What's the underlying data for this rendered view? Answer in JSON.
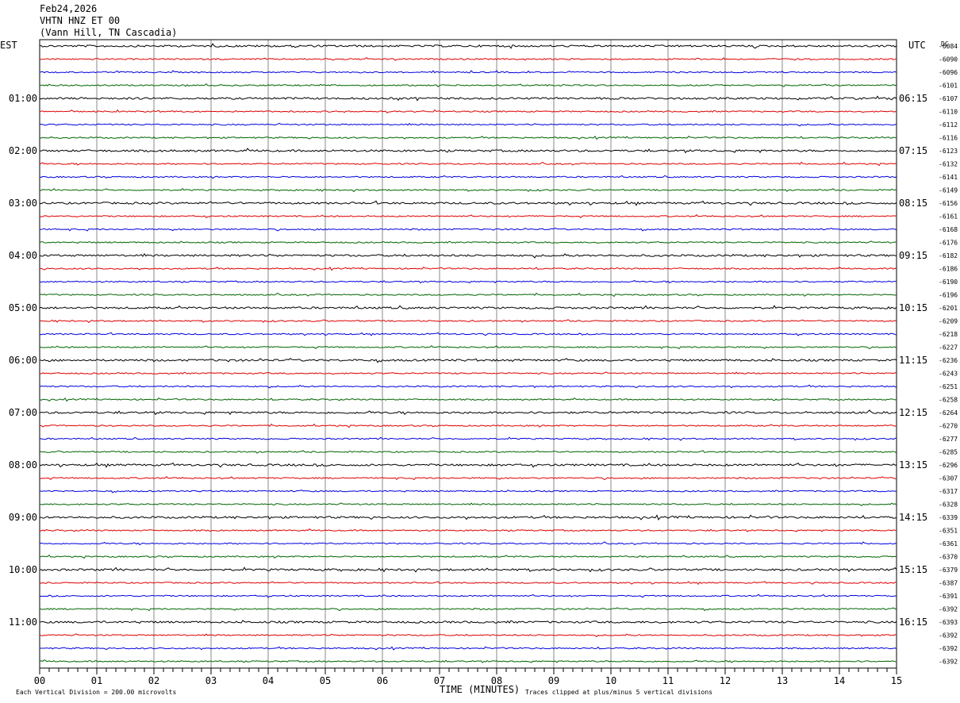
{
  "header": {
    "date": "Feb24,2026",
    "station": "VHTN HNZ ET 00",
    "location": "(Vann Hill, TN Cascadia)"
  },
  "chart_data": {
    "type": "line",
    "left_zone": "EST",
    "right_zone": "UTC",
    "dc_label": "DC",
    "xlabel": "TIME (MINUTES)",
    "x_ticks": [
      "00",
      "01",
      "02",
      "03",
      "04",
      "05",
      "06",
      "07",
      "08",
      "09",
      "10",
      "11",
      "12",
      "13",
      "14",
      "15"
    ],
    "xlim": [
      0,
      15
    ],
    "est_labels": [
      "01:00",
      "02:00",
      "03:00",
      "04:00",
      "05:00",
      "06:00",
      "07:00",
      "08:00",
      "09:00",
      "10:00",
      "11:00"
    ],
    "utc_labels": [
      "06:15",
      "07:15",
      "08:15",
      "09:15",
      "10:15",
      "11:15",
      "12:15",
      "13:15",
      "14:15",
      "15:15",
      "16:15"
    ],
    "dc_offsets": [
      "-6084",
      "-6090",
      "-6096",
      "-6101",
      "-6107",
      "-6110",
      "-6112",
      "-6116",
      "-6123",
      "-6132",
      "-6141",
      "-6149",
      "-6156",
      "-6161",
      "-6168",
      "-6176",
      "-6182",
      "-6186",
      "-6190",
      "-6196",
      "-6201",
      "-6209",
      "-6218",
      "-6227",
      "-6236",
      "-6243",
      "-6251",
      "-6258",
      "-6264",
      "-6270",
      "-6277",
      "-6285",
      "-6296",
      "-6307",
      "-6317",
      "-6328",
      "-6339",
      "-6351",
      "-6361",
      "-6370",
      "-6379",
      "-6387",
      "-6391",
      "-6392",
      "-6393",
      "-6392",
      "-6392",
      "-6392"
    ],
    "trace_colors": [
      "#000000",
      "#e00000",
      "#0000e0",
      "#006400"
    ],
    "scale_note": "Each Vertical Division =  200.00 microvolts",
    "clip_note": "Traces clipped at plus/minus 5 vertical divisions"
  }
}
